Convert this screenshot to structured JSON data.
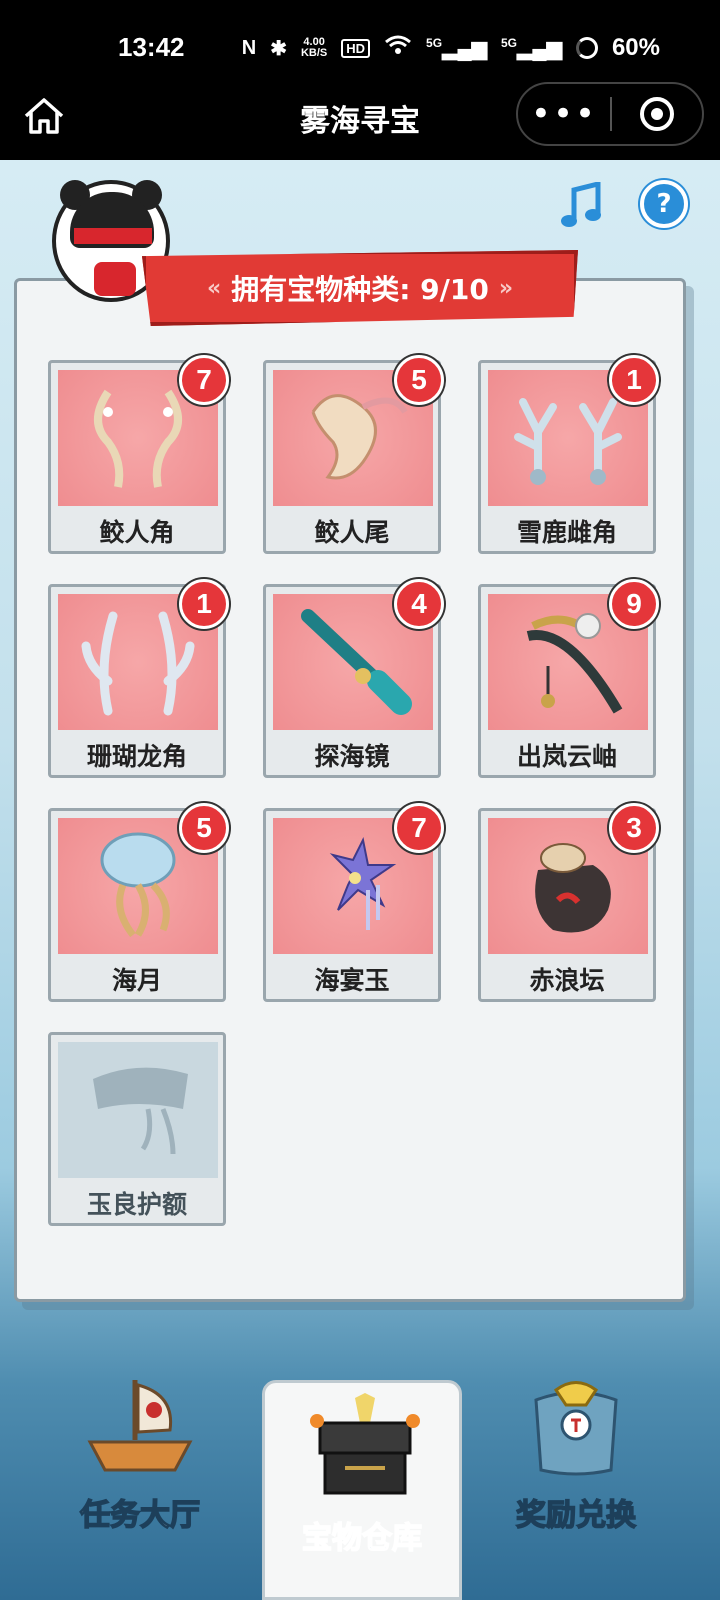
{
  "status_bar": {
    "time": "13:42",
    "speed_top": "4.00",
    "speed_bottom": "KB/S",
    "hd_label": "HD",
    "net1": "5G",
    "net2": "5G",
    "battery": "60%"
  },
  "nav": {
    "title": "雾海寻宝",
    "more_label": "•••"
  },
  "header": {
    "help_label": "?",
    "banner_label": "拥有宝物种类: 9/10"
  },
  "items": [
    {
      "name": "鲛人角",
      "count": "7",
      "color": "#e9d8b6"
    },
    {
      "name": "鲛人尾",
      "count": "5",
      "color": "#f1dcc1"
    },
    {
      "name": "雪鹿雌角",
      "count": "1",
      "color": "#cfe0ea"
    },
    {
      "name": "珊瑚龙角",
      "count": "1",
      "color": "#dfe7f0"
    },
    {
      "name": "探海镜",
      "count": "4",
      "color": "#1f7f86"
    },
    {
      "name": "出岚云岫",
      "count": "9",
      "color": "#2e3a3a"
    },
    {
      "name": "海月",
      "count": "5",
      "color": "#b9dcee"
    },
    {
      "name": "海宴玉",
      "count": "7",
      "color": "#7b74d6"
    },
    {
      "name": "赤浪坛",
      "count": "3",
      "color": "#3d3434"
    },
    {
      "name": "玉良护额",
      "count": "",
      "color": "#9fb2bc"
    }
  ],
  "tabs": [
    {
      "label": "任务大厅"
    },
    {
      "label": "宝物仓库"
    },
    {
      "label": "奖励兑换"
    }
  ]
}
